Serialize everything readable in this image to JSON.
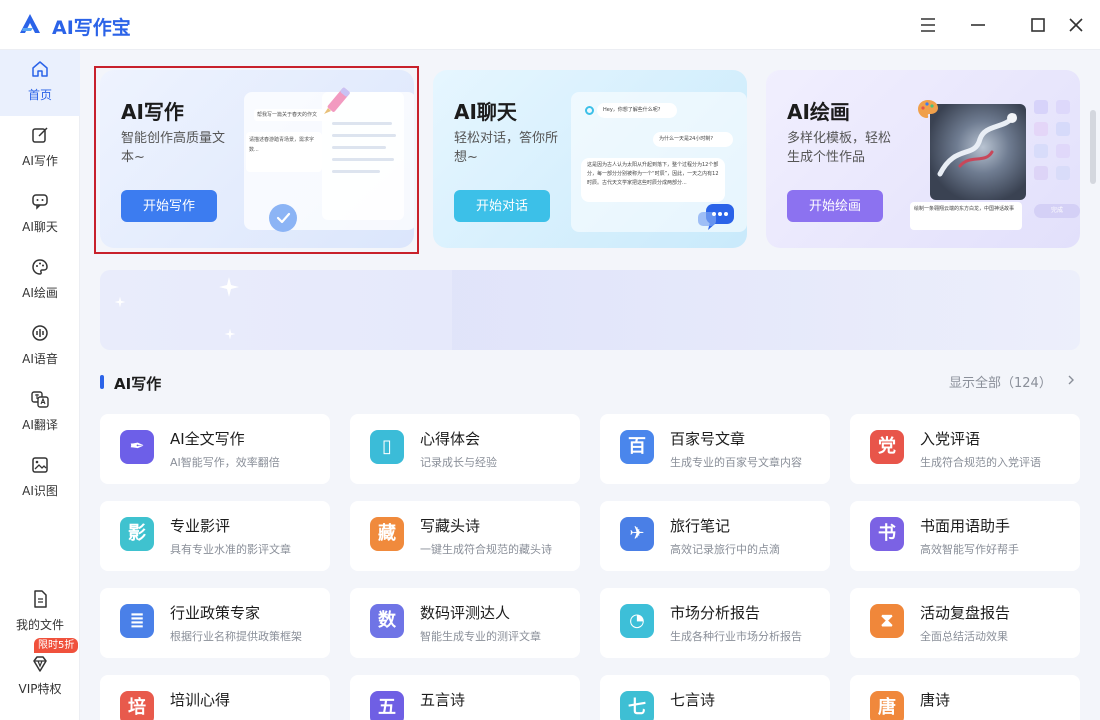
{
  "app": {
    "title": "AI写作宝"
  },
  "sidebar": {
    "items": [
      {
        "label": "首页",
        "icon": "home-icon"
      },
      {
        "label": "AI写作",
        "icon": "edit-icon"
      },
      {
        "label": "AI聊天",
        "icon": "chat-icon"
      },
      {
        "label": "AI绘画",
        "icon": "palette-icon"
      },
      {
        "label": "AI语音",
        "icon": "voice-icon"
      },
      {
        "label": "AI翻译",
        "icon": "translate-icon"
      },
      {
        "label": "AI识图",
        "icon": "image-recognition-icon"
      }
    ],
    "files_label": "我的文件",
    "vip_label": "VIP特权",
    "vip_badge": "限时5折"
  },
  "features": [
    {
      "title": "AI写作",
      "desc": "智能创作高质量文本~",
      "button": "开始写作",
      "illus_bar": "帮我写一篇关于春天的作文",
      "illus_note": "请描述春游踏青场景，需求字数..."
    },
    {
      "title": "AI聊天",
      "desc": "轻松对话，答你所想~",
      "button": "开始对话",
      "bubble1": "Hey，你想了解些什么呢?",
      "bubble2": "为什么一天是24小时制?",
      "bubble3": "这是因为古人认为太阳从升起到落下，整个过程分为12个部分，每一部分分别被称为一个“时辰”，因此，一天之内有12时辰。古代天文学家把这些时辰分成两部分..."
    },
    {
      "title": "AI绘画",
      "desc": "多样化模板，轻松生成个性作品",
      "button": "开始绘画",
      "caption": "绘制一条翱翔云端的东方白龙，中国神话故事",
      "done": "完成"
    }
  ],
  "section": {
    "title": "AI写作",
    "show_all": "显示全部（124）"
  },
  "colors": {
    "accent": "#2b63e8",
    "highlight_border": "#c8212b"
  },
  "tools": [
    {
      "title": "AI全文写作",
      "desc": "AI智能写作，效率翻倍",
      "icon_char": "✒",
      "color": "#6d5fe8"
    },
    {
      "title": "心得体会",
      "desc": "记录成长与经验",
      "icon_char": "▯",
      "color": "#3bbcd8"
    },
    {
      "title": "百家号文章",
      "desc": "生成专业的百家号文章内容",
      "icon_char": "百",
      "color": "#4a86ec"
    },
    {
      "title": "入党评语",
      "desc": "生成符合规范的入党评语",
      "icon_char": "党",
      "color": "#e8554a"
    },
    {
      "title": "专业影评",
      "desc": "具有专业水准的影评文章",
      "icon_char": "影",
      "color": "#3fc2cf"
    },
    {
      "title": "写藏头诗",
      "desc": "一键生成符合规范的藏头诗",
      "icon_char": "藏",
      "color": "#f08a3c"
    },
    {
      "title": "旅行笔记",
      "desc": "高效记录旅行中的点滴",
      "icon_char": "✈",
      "color": "#4a7fe6"
    },
    {
      "title": "书面用语助手",
      "desc": "高效智能写作好帮手",
      "icon_char": "书",
      "color": "#7b62e4"
    },
    {
      "title": "行业政策专家",
      "desc": "根据行业名称提供政策框架",
      "icon_char": "≣",
      "color": "#4a80e8"
    },
    {
      "title": "数码评测达人",
      "desc": "智能生成专业的测评文章",
      "icon_char": "数",
      "color": "#6f74e6"
    },
    {
      "title": "市场分析报告",
      "desc": "生成各种行业市场分析报告",
      "icon_char": "◔",
      "color": "#3dbfd8"
    },
    {
      "title": "活动复盘报告",
      "desc": "全面总结活动效果",
      "icon_char": "⧗",
      "color": "#f0873a"
    },
    {
      "title": "培训心得",
      "desc": "",
      "icon_char": "培",
      "color": "#e85a4c"
    },
    {
      "title": "五言诗",
      "desc": "",
      "icon_char": "五",
      "color": "#6f5fe4"
    },
    {
      "title": "七言诗",
      "desc": "",
      "icon_char": "七",
      "color": "#3ebfd4"
    },
    {
      "title": "唐诗",
      "desc": "",
      "icon_char": "唐",
      "color": "#f0883c"
    }
  ]
}
